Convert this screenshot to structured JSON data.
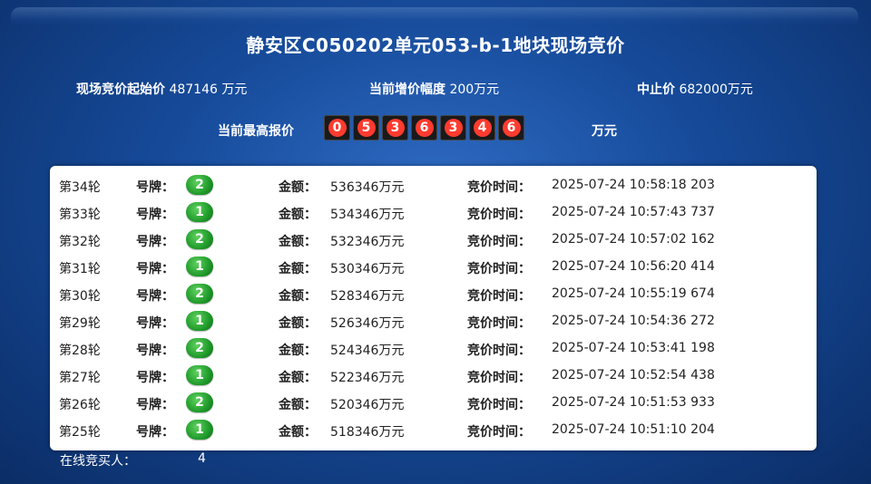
{
  "title": "静安区C050202单元053-b-1地块现场竞价",
  "info": {
    "start_price_label": "现场竞价起始价",
    "start_price_value": "487146 万元",
    "increment_label": "当前增价幅度",
    "increment_value": "200万元",
    "stop_price_label": "中止价",
    "stop_price_value": "682000万元"
  },
  "highest_bid": {
    "label": "当前最高报价",
    "digits": [
      "0",
      "5",
      "3",
      "6",
      "3",
      "4",
      "6"
    ],
    "unit": "万元"
  },
  "labels": {
    "plate": "号牌：",
    "amount": "金额：",
    "time": "竞价时间："
  },
  "rounds": [
    {
      "round": "第34轮",
      "plate": "2",
      "amount": "536346万元",
      "time": "2025-07-24 10:58:18 203"
    },
    {
      "round": "第33轮",
      "plate": "1",
      "amount": "534346万元",
      "time": "2025-07-24 10:57:43 737"
    },
    {
      "round": "第32轮",
      "plate": "2",
      "amount": "532346万元",
      "time": "2025-07-24 10:57:02 162"
    },
    {
      "round": "第31轮",
      "plate": "1",
      "amount": "530346万元",
      "time": "2025-07-24 10:56:20 414"
    },
    {
      "round": "第30轮",
      "plate": "2",
      "amount": "528346万元",
      "time": "2025-07-24 10:55:19 674"
    },
    {
      "round": "第29轮",
      "plate": "1",
      "amount": "526346万元",
      "time": "2025-07-24 10:54:36 272"
    },
    {
      "round": "第28轮",
      "plate": "2",
      "amount": "524346万元",
      "time": "2025-07-24 10:53:41 198"
    },
    {
      "round": "第27轮",
      "plate": "1",
      "amount": "522346万元",
      "time": "2025-07-24 10:52:54 438"
    },
    {
      "round": "第26轮",
      "plate": "2",
      "amount": "520346万元",
      "time": "2025-07-24 10:51:53 933"
    },
    {
      "round": "第25轮",
      "plate": "1",
      "amount": "518346万元",
      "time": "2025-07-24 10:51:10 204"
    }
  ],
  "online": {
    "label": "在线竞买人：",
    "count": "4"
  },
  "colors": {
    "background": "#164a99",
    "digit_red": "#ff3b2f",
    "badge_green": "#1f9a2a"
  }
}
